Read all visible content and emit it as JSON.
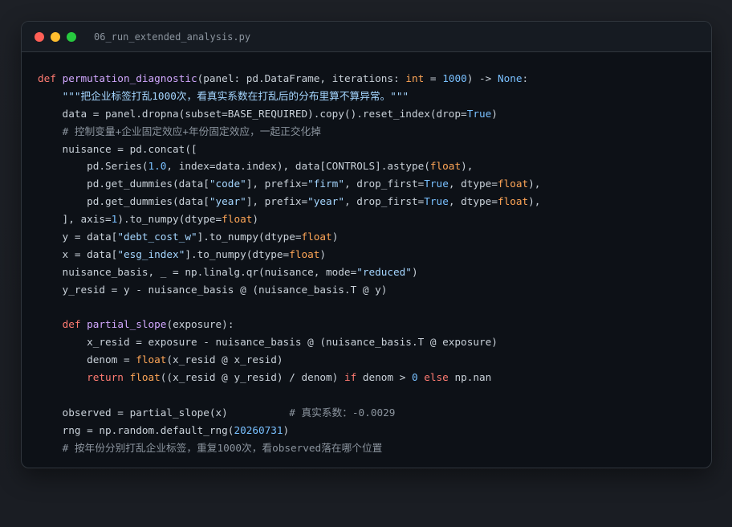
{
  "window": {
    "filename": "06_run_extended_analysis.py",
    "controls": [
      "close",
      "minimize",
      "maximize"
    ]
  },
  "code_lines": [
    [
      {
        "t": "def ",
        "c": "kw"
      },
      {
        "t": "permutation_diagnostic",
        "c": "fn"
      },
      {
        "t": "(panel: pd.DataFrame, iterations: ",
        "c": ""
      },
      {
        "t": "int",
        "c": "ty"
      },
      {
        "t": " = ",
        "c": ""
      },
      {
        "t": "1000",
        "c": "num"
      },
      {
        "t": ") -> ",
        "c": ""
      },
      {
        "t": "None",
        "c": "bi"
      },
      {
        "t": ":",
        "c": ""
      }
    ],
    [
      {
        "t": "    ",
        "c": ""
      },
      {
        "t": "\"\"\"把企业标签打乱1000次，看真实系数在打乱后的分布里算不算异常。\"\"\"",
        "c": "str"
      }
    ],
    [
      {
        "t": "    data = panel.dropna(subset=BASE_REQUIRED).copy().reset_index(drop=",
        "c": ""
      },
      {
        "t": "True",
        "c": "bi"
      },
      {
        "t": ")",
        "c": ""
      }
    ],
    [
      {
        "t": "    ",
        "c": ""
      },
      {
        "t": "# 控制变量+企业固定效应+年份固定效应，一起正交化掉",
        "c": "cmt"
      }
    ],
    [
      {
        "t": "    nuisance = pd.concat([",
        "c": ""
      }
    ],
    [
      {
        "t": "        pd.Series(",
        "c": ""
      },
      {
        "t": "1.0",
        "c": "num"
      },
      {
        "t": ", index=data.index), data[CONTROLS].astype(",
        "c": ""
      },
      {
        "t": "float",
        "c": "ty"
      },
      {
        "t": "),",
        "c": ""
      }
    ],
    [
      {
        "t": "        pd.get_dummies(data[",
        "c": ""
      },
      {
        "t": "\"code\"",
        "c": "str"
      },
      {
        "t": "], prefix=",
        "c": ""
      },
      {
        "t": "\"firm\"",
        "c": "str"
      },
      {
        "t": ", drop_first=",
        "c": ""
      },
      {
        "t": "True",
        "c": "bi"
      },
      {
        "t": ", dtype=",
        "c": ""
      },
      {
        "t": "float",
        "c": "ty"
      },
      {
        "t": "),",
        "c": ""
      }
    ],
    [
      {
        "t": "        pd.get_dummies(data[",
        "c": ""
      },
      {
        "t": "\"year\"",
        "c": "str"
      },
      {
        "t": "], prefix=",
        "c": ""
      },
      {
        "t": "\"year\"",
        "c": "str"
      },
      {
        "t": ", drop_first=",
        "c": ""
      },
      {
        "t": "True",
        "c": "bi"
      },
      {
        "t": ", dtype=",
        "c": ""
      },
      {
        "t": "float",
        "c": "ty"
      },
      {
        "t": "),",
        "c": ""
      }
    ],
    [
      {
        "t": "    ], axis=",
        "c": ""
      },
      {
        "t": "1",
        "c": "num"
      },
      {
        "t": ").to_numpy(dtype=",
        "c": ""
      },
      {
        "t": "float",
        "c": "ty"
      },
      {
        "t": ")",
        "c": ""
      }
    ],
    [
      {
        "t": "    y = data[",
        "c": ""
      },
      {
        "t": "\"debt_cost_w\"",
        "c": "str"
      },
      {
        "t": "].to_numpy(dtype=",
        "c": ""
      },
      {
        "t": "float",
        "c": "ty"
      },
      {
        "t": ")",
        "c": ""
      }
    ],
    [
      {
        "t": "    x = data[",
        "c": ""
      },
      {
        "t": "\"esg_index\"",
        "c": "str"
      },
      {
        "t": "].to_numpy(dtype=",
        "c": ""
      },
      {
        "t": "float",
        "c": "ty"
      },
      {
        "t": ")",
        "c": ""
      }
    ],
    [
      {
        "t": "    nuisance_basis, _ = np.linalg.qr(nuisance, mode=",
        "c": ""
      },
      {
        "t": "\"reduced\"",
        "c": "str"
      },
      {
        "t": ")",
        "c": ""
      }
    ],
    [
      {
        "t": "    y_resid = y - nuisance_basis @ (nuisance_basis.T @ y)",
        "c": ""
      }
    ],
    [],
    [
      {
        "t": "    ",
        "c": ""
      },
      {
        "t": "def ",
        "c": "kw"
      },
      {
        "t": "partial_slope",
        "c": "fn"
      },
      {
        "t": "(exposure):",
        "c": ""
      }
    ],
    [
      {
        "t": "        x_resid = exposure - nuisance_basis @ (nuisance_basis.T @ exposure)",
        "c": ""
      }
    ],
    [
      {
        "t": "        denom = ",
        "c": ""
      },
      {
        "t": "float",
        "c": "ty"
      },
      {
        "t": "(x_resid @ x_resid)",
        "c": ""
      }
    ],
    [
      {
        "t": "        ",
        "c": ""
      },
      {
        "t": "return ",
        "c": "kw"
      },
      {
        "t": "float",
        "c": "ty"
      },
      {
        "t": "((x_resid @ y_resid) / denom) ",
        "c": ""
      },
      {
        "t": "if",
        "c": "kw"
      },
      {
        "t": " denom > ",
        "c": ""
      },
      {
        "t": "0",
        "c": "num"
      },
      {
        "t": " ",
        "c": ""
      },
      {
        "t": "else",
        "c": "kw"
      },
      {
        "t": " np.nan",
        "c": ""
      }
    ],
    [],
    [
      {
        "t": "    observed = partial_slope(x)          ",
        "c": ""
      },
      {
        "t": "# 真实系数：-0.0029",
        "c": "cmt"
      }
    ],
    [
      {
        "t": "    rng = np.random.default_rng(",
        "c": ""
      },
      {
        "t": "20260731",
        "c": "num"
      },
      {
        "t": ")",
        "c": ""
      }
    ],
    [
      {
        "t": "    ",
        "c": ""
      },
      {
        "t": "# 按年份分别打乱企业标签，重复1000次，看observed落在哪个位置",
        "c": "cmt"
      }
    ]
  ]
}
